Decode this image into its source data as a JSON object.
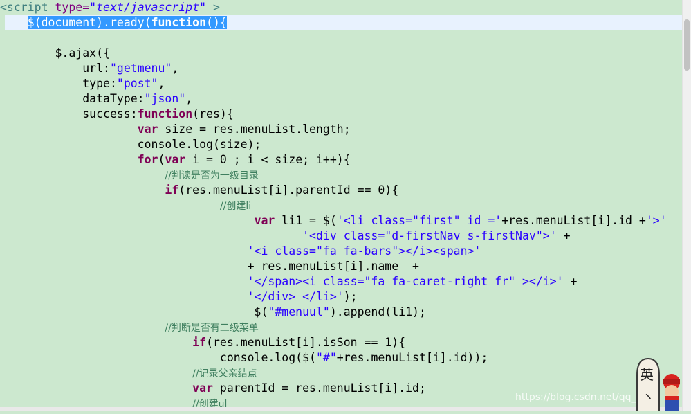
{
  "code": {
    "l1": {
      "open": "<script",
      "attr": " type=",
      "val": "\"text/javascript\"",
      "close": " >"
    },
    "l2": {
      "indent": "    ",
      "selected_pre": "$(document).ready(",
      "selected_kw": "function",
      "selected_post": "(){"
    },
    "l4": {
      "text": "        $.ajax({"
    },
    "l5": {
      "text": "            url:",
      "str": "\"getmenu\"",
      "post": ","
    },
    "l6": {
      "text": "            type:",
      "str": "\"post\"",
      "post": ","
    },
    "l7": {
      "text": "            dataType:",
      "str": "\"json\"",
      "post": ","
    },
    "l8": {
      "text": "            success:",
      "kw": "function",
      "post": "(res){"
    },
    "l9": {
      "indent": "                    ",
      "kw": "var",
      "post": " size = res.menuList.length;"
    },
    "l10": {
      "text": "                    console.log(size);"
    },
    "l11": {
      "indent": "                    ",
      "kw1": "for",
      "mid": "(",
      "kw2": "var",
      "post": " i = 0 ; i < size; i++){"
    },
    "l12": {
      "indent": "                        ",
      "comment": "//判读是否为一级目录"
    },
    "l13": {
      "indent": "                        ",
      "kw": "if",
      "post": "(res.menuList[i].parentId == 0){"
    },
    "l14": {
      "indent": "                                ",
      "comment": "//创建li"
    },
    "l15": {
      "indent": "                                     ",
      "kw": "var",
      "post": " li1 = $(",
      "str": "'<li class=\"first\" id ='",
      "post2": "+res.menuList[i].id +",
      "str2": "'>'"
    },
    "l16": {
      "indent": "                                            ",
      "str": "'<div class=\"d-firstNav s-firstNav\">'",
      "post": " +"
    },
    "l17": {
      "indent": "                                    ",
      "str": "'<i class=\"fa fa-bars\"></i><span>'"
    },
    "l18": {
      "text": "                                    + res.menuList[i].name  +"
    },
    "l19": {
      "indent": "                                    ",
      "str": "'</span><i class=\"fa fa-caret-right fr\" ></i>'",
      "post": " +"
    },
    "l20": {
      "indent": "                                    ",
      "str": "'</div> </li>'",
      "post": ");"
    },
    "l21": {
      "indent": "                                     $(",
      "str": "\"#menuul\"",
      "post": ").append(li1);"
    },
    "l22": {
      "indent": "                        ",
      "comment": "//判断是否有二级菜单"
    },
    "l23": {
      "indent": "                            ",
      "kw": "if",
      "post": "(res.menuList[i].isSon == 1){"
    },
    "l24": {
      "indent": "                                console.log($(",
      "str": "\"#\"",
      "post": "+res.menuList[i].id));"
    },
    "l25": {
      "indent": "                            ",
      "comment": "//记录父亲结点"
    },
    "l26": {
      "indent": "                            ",
      "kw": "var",
      "post": " parentId = res.menuList[i].id;"
    },
    "l27": {
      "indent": "                            ",
      "comment": "//创建ul"
    }
  },
  "watermark": "https://blog.csdn.net/qq_",
  "ime_label": "英",
  "colors": {
    "background": "#cce8cf",
    "selection": "#3399ff",
    "keyword": "#7f0055",
    "string": "#2a00ff",
    "comment": "#3f7f5f"
  }
}
